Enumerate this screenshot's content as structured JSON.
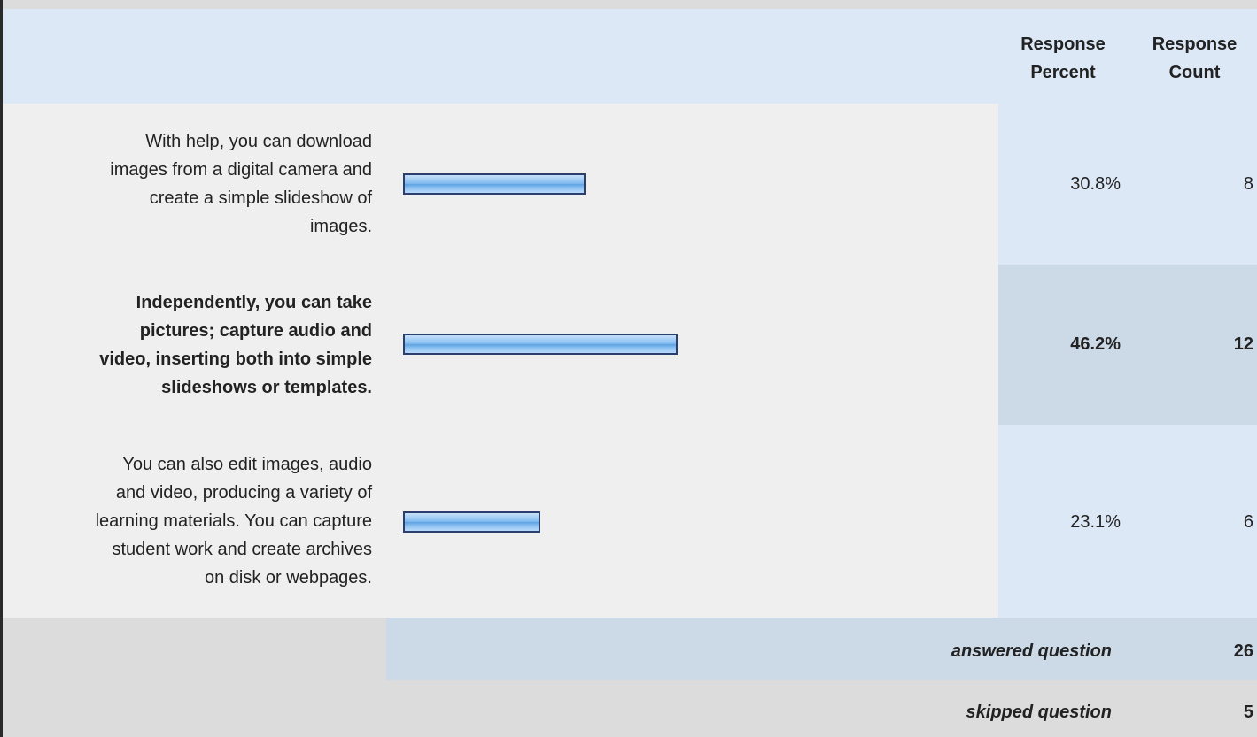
{
  "header": {
    "response_percent": [
      "Response",
      "Percent"
    ],
    "response_count": [
      "Response",
      "Count"
    ]
  },
  "colors": {
    "bar_fill": "#7fb8ee",
    "bar_border": "#2a3f6e",
    "header_bg": "#dce8f5",
    "highlight_bg": "#ccdae8"
  },
  "chart_data": {
    "type": "bar",
    "orientation": "horizontal",
    "categories": [
      "With help, you can download images from a digital camera and create a simple slideshow of images.",
      "Independently, you can take pictures; capture audio and video, inserting both into simple slideshows or templates.",
      "You can also edit images, audio and video, producing a variety of learning materials. You can capture student work and create archives on disk or webpages."
    ],
    "series": [
      {
        "values": [
          30.8,
          46.2,
          23.1
        ]
      }
    ],
    "percent_labels": [
      "30.8%",
      "46.2%",
      "23.1%"
    ],
    "counts": [
      "8",
      "12",
      "6"
    ],
    "xlim": [
      0,
      100
    ],
    "grid": false,
    "highlighted_index": 1
  },
  "rows": [
    {
      "label_lines": [
        "With help, you can download",
        "images from a digital camera and",
        "create a simple slideshow of",
        "images."
      ],
      "percent": "30.8%",
      "count": "8"
    },
    {
      "label_lines": [
        "Independently, you can take",
        "pictures; capture audio and",
        "video, inserting both into simple",
        "slideshows or templates."
      ],
      "percent": "46.2%",
      "count": "12"
    },
    {
      "label_lines": [
        "You can also edit images, audio",
        "and video, producing a variety of",
        "learning materials. You can capture",
        "student work and create archives",
        "on disk or webpages."
      ],
      "percent": "23.1%",
      "count": "6"
    }
  ],
  "summary": {
    "answered_label": "answered question",
    "answered_value": "26",
    "skipped_label": "skipped question",
    "skipped_value": "5"
  }
}
